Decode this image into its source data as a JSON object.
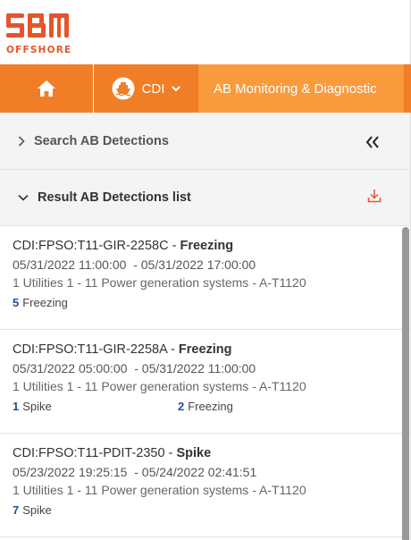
{
  "brand": {
    "name": "OFFSHORE",
    "logo_color": "#e8542a"
  },
  "navbar": {
    "home_icon": "home-icon",
    "site_label": "CDI",
    "app_label": "AB Monitoring & Diagnostic",
    "color": "#f07e26",
    "active_color": "#f99a3d"
  },
  "search_section": {
    "label": "Search AB Detections",
    "collapse_icon": "double-chevron-left-icon"
  },
  "result_section": {
    "label": "Result AB Detections list",
    "download_icon": "download-icon"
  },
  "items": [
    {
      "tag": "CDI:FPSO:T11-GIR-2258C",
      "type": "Freezing",
      "dates": "05/31/2022 11:00:00  - 05/31/2022 17:00:00",
      "system": "1 Utilities 1 - 11 Power generation systems - A-T1120",
      "counts": [
        {
          "num": "5",
          "label": "Freezing"
        }
      ]
    },
    {
      "tag": "CDI:FPSO:T11-GIR-2258A",
      "type": "Freezing",
      "dates": "05/31/2022 05:00:00  - 05/31/2022 11:00:00",
      "system": "1 Utilities 1 - 11 Power generation systems - A-T1120",
      "counts": [
        {
          "num": "1",
          "label": "Spike"
        },
        {
          "num": "2",
          "label": "Freezing"
        }
      ]
    },
    {
      "tag": "CDI:FPSO:T11-PDIT-2350",
      "type": "Spike",
      "dates": "05/23/2022 19:25:15  - 05/24/2022 02:41:51",
      "system": "1 Utilities 1 - 11 Power generation systems - A-T1120",
      "counts": [
        {
          "num": "7",
          "label": "Spike"
        }
      ]
    }
  ]
}
